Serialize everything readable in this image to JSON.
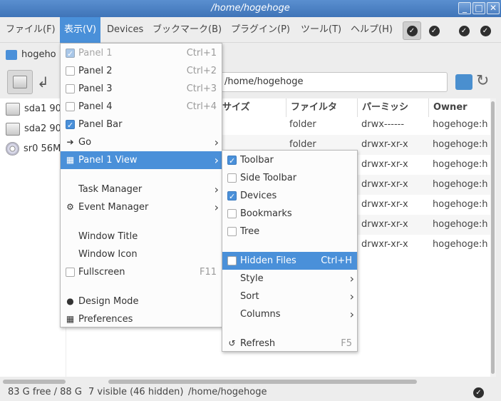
{
  "window": {
    "title": "/home/hogehoge",
    "buttons": [
      "_",
      "□",
      "✕"
    ]
  },
  "menubar": {
    "items": [
      "ファイル(F)",
      "表示(V)",
      "Devices",
      "ブックマーク(B)",
      "プラグイン(P)",
      "ツール(T)",
      "ヘルプ(H)"
    ],
    "active_index": 1,
    "toolbar_checks": 4
  },
  "tab": {
    "label": "hogeho"
  },
  "location": {
    "path": "/home/hogehoge"
  },
  "devices": [
    {
      "label": "sda1 90",
      "icon": "drive-icon"
    },
    {
      "label": "sda2 90",
      "icon": "drive-icon"
    },
    {
      "label": "sr0 56M",
      "icon": "cdrom-icon"
    }
  ],
  "file_list": {
    "columns": [
      "サイズ",
      "ファイルタ",
      "パーミッシ",
      "Owner"
    ],
    "rows": [
      {
        "type": "folder",
        "perm": "drwx------",
        "owner": "hogehoge:h"
      },
      {
        "type": "folder",
        "perm": "drwxr-xr-x",
        "owner": "hogehoge:h"
      },
      {
        "type": "",
        "perm": "drwxr-xr-x",
        "owner": "hogehoge:h"
      },
      {
        "type": "",
        "perm": "drwxr-xr-x",
        "owner": "hogehoge:h"
      },
      {
        "type": "",
        "perm": "drwxr-xr-x",
        "owner": "hogehoge:h"
      },
      {
        "type": "",
        "perm": "drwxr-xr-x",
        "owner": "hogehoge:h"
      },
      {
        "type": "",
        "perm": "drwxr-xr-x",
        "owner": "hogehoge:h"
      }
    ]
  },
  "view_menu": {
    "items": [
      {
        "label": "Panel 1",
        "accel": "Ctrl+1",
        "check": "checked-disabled",
        "disabled": true
      },
      {
        "label": "Panel 2",
        "accel": "Ctrl+2",
        "check": "unchecked"
      },
      {
        "label": "Panel 3",
        "accel": "Ctrl+3",
        "check": "unchecked"
      },
      {
        "label": "Panel 4",
        "accel": "Ctrl+4",
        "check": "unchecked"
      },
      {
        "label": "Panel Bar",
        "accel": "",
        "check": "checked"
      },
      {
        "label": "Go",
        "icon": "go-arrow-icon",
        "submenu": true
      },
      {
        "label": "Panel 1 View",
        "icon": "panel-view-icon",
        "submenu": true,
        "highlighted": true
      },
      {
        "label": "Task Manager",
        "submenu": true
      },
      {
        "label": "Event Manager",
        "icon": "gear-icon",
        "submenu": true
      },
      {
        "label": "Window Title"
      },
      {
        "label": "Window Icon"
      },
      {
        "label": "Fullscreen",
        "accel": "F11",
        "check": "unchecked"
      },
      {
        "label": "Design Mode",
        "icon": "speech-bubble-icon"
      },
      {
        "label": "Preferences",
        "icon": "preferences-icon"
      }
    ]
  },
  "panel_view_menu": {
    "items": [
      {
        "label": "Toolbar",
        "check": "checked"
      },
      {
        "label": "Side Toolbar",
        "check": "unchecked"
      },
      {
        "label": "Devices",
        "check": "checked"
      },
      {
        "label": "Bookmarks",
        "check": "unchecked"
      },
      {
        "label": "Tree",
        "check": "unchecked"
      },
      {
        "label": "Hidden Files",
        "accel": "Ctrl+H",
        "check": "unchecked",
        "highlighted": true
      },
      {
        "label": "Style",
        "submenu": true
      },
      {
        "label": "Sort",
        "submenu": true
      },
      {
        "label": "Columns",
        "submenu": true
      },
      {
        "label": "Refresh",
        "accel": "F5",
        "icon": "refresh-icon"
      }
    ]
  },
  "status": {
    "free": "83 G free / 88 G",
    "visible": "7 visible (46 hidden)",
    "path": "/home/hogehoge"
  },
  "colors": {
    "accent": "#4a90d9",
    "titlebar": "#4a80c4"
  }
}
